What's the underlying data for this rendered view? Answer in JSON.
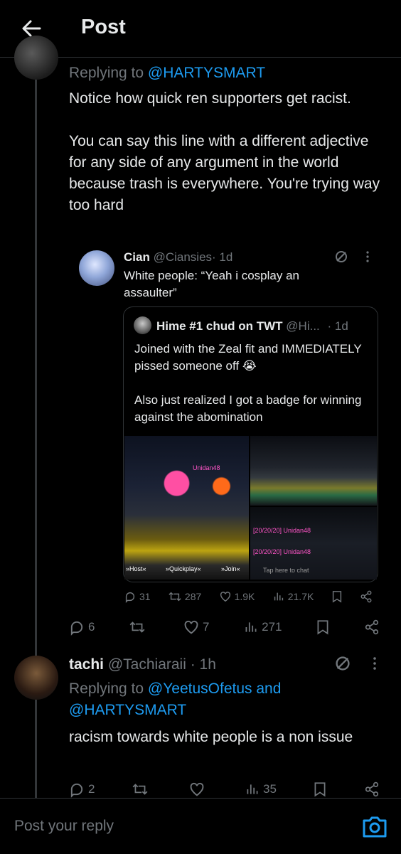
{
  "header": {
    "title": "Post",
    "back_icon": "arrow-left-icon"
  },
  "reply_top": {
    "replying_prefix": "Replying to ",
    "replying_handle": "@HARTYSMART",
    "body": "Notice how quick ren supporters get racist.\n\nYou can say this line with a different adjective for any side of any argument in the world because trash is everywhere. You're trying way too hard",
    "stats": {
      "replies": "6",
      "reposts": "",
      "likes": "7",
      "views": "271"
    }
  },
  "quote_cian": {
    "name": "Cian",
    "handle": "@Ciansies",
    "time": "· 1d",
    "body": "White people: “Yeah i cosplay an assaulter”"
  },
  "quote_hime": {
    "name": "Hime #1 chud on TWT",
    "handle": "@Hi...",
    "time": "· 1d",
    "body": "Joined with the Zeal fit and IMMEDIATELY pissed someone off 😭\n\nAlso just realized I got a badge for winning against the abomination",
    "stats": {
      "replies": "31",
      "reposts": "287",
      "likes": "1.9K",
      "views": "21.7K"
    },
    "game_labels": {
      "username_tag": "Unidan48",
      "host": "»Host«",
      "quickplay": "»Quickplay«",
      "join": "»Join«",
      "chat_line_1": "[20/20/20] Unidan48",
      "chat_line_2": "[20/20/20] Unidan48",
      "chat_placeholder": "Tap here to chat"
    }
  },
  "tachi": {
    "name": "tachi",
    "handle": "@Tachiaraii",
    "time": "· 1h",
    "replying_prefix": "Replying to ",
    "replying_handles": "@YeetusOfetus and @HARTYSMART",
    "body": "racism towards white people is a non issue",
    "stats": {
      "replies": "2",
      "reposts": "",
      "likes": "",
      "views": "35"
    }
  },
  "composer": {
    "placeholder": "Post your reply",
    "camera_icon": "camera-icon"
  },
  "colors": {
    "background": "#000000",
    "text": "#e7e9ea",
    "muted": "#71767b",
    "link": "#1d9bf0",
    "border": "#2f3336"
  }
}
